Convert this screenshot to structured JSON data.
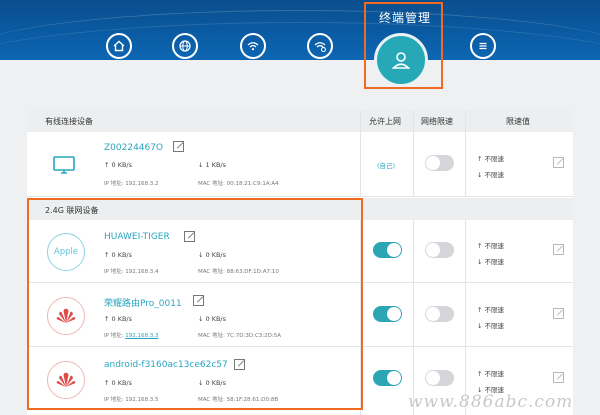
{
  "nav": {
    "active_title": "终端管理",
    "icons": [
      "home-icon",
      "globe-icon",
      "wifi-icon",
      "wifi-settings-icon",
      "user-icon",
      "menu-icon"
    ]
  },
  "table": {
    "headers": {
      "wired": "有线连接设备",
      "allow": "允许上网",
      "limit": "网络限速",
      "limit_value": "限速值"
    },
    "wired_device": {
      "name": "Z00224467O",
      "up": "↑ 0 KB/s",
      "down": "↓ 1 KB/s",
      "ip": "IP 地址: 192.168.3.2",
      "mac": "MAC 地址: 00:18:21:C9:1A:A4",
      "self_label": "(自己)",
      "limit_up": "↑ 不限速",
      "limit_down": "↓ 不限速"
    },
    "section_24g": "2.4G 联网设备",
    "devices": [
      {
        "name": "HUAWEI-TIGER",
        "logo": "Apple",
        "up": "↑ 0 KB/s",
        "down": "↓ 0 KB/s",
        "ip": "IP 地址: 192.168.3.4",
        "mac": "MAC 地址: 88:63:DF:1D:A7:10",
        "allow": true,
        "limit_up": "↑ 不限速",
        "limit_down": "↓ 不限速"
      },
      {
        "name": "荣耀路由Pro_0011",
        "logo": "huawei",
        "up": "↑ 0 KB/s",
        "down": "↓ 0 KB/s",
        "ip_prefix": "IP 地址: ",
        "ip_link": "192.168.3.3",
        "mac": "MAC 地址: 7C:7D:3D:C3:2D:5A",
        "allow": true,
        "limit_up": "↑ 不限速",
        "limit_down": "↓ 不限速"
      },
      {
        "name": "android-f3160ac13ce62c57",
        "logo": "huawei",
        "up": "↑ 0 KB/s",
        "down": "↓ 0 KB/s",
        "ip": "IP 地址: 192.168.3.5",
        "mac": "MAC 地址: 58:1F:28:61:D0:8B",
        "allow": true,
        "limit_up": "↑ 不限速",
        "limit_down": "↓ 不限速"
      }
    ]
  },
  "watermark": "www.886abc.com",
  "colors": {
    "accent": "#2ba7b4",
    "highlight": "#f06a21",
    "header": "#0a5ba3"
  }
}
